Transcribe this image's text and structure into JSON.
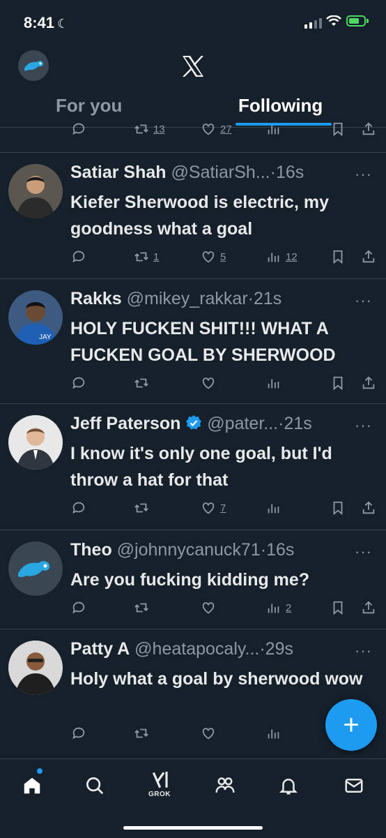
{
  "status_bar": {
    "time": "8:41",
    "focus_icon": "moon-icon",
    "signal": "signal-icon",
    "wifi": "wifi-icon",
    "battery": "battery-charging-icon"
  },
  "header": {
    "logo": "x-logo",
    "profile_avatar": "user-avatar"
  },
  "tabs": [
    {
      "label": "For you",
      "active": false
    },
    {
      "label": "Following",
      "active": true
    }
  ],
  "partial_tweet": {
    "retweets": "13",
    "likes": "27"
  },
  "tweets": [
    {
      "name": "Satiar Shah",
      "handle": "@SatiarSh...",
      "time": "·16s",
      "verified": false,
      "text": "Kiefer Sherwood is electric, my goodness what a goal",
      "replies": "",
      "retweets": "1",
      "likes": "5",
      "views": "12"
    },
    {
      "name": "Rakks",
      "handle": "@mikey_rakkar",
      "time": "·21s",
      "verified": false,
      "text": "HOLY FUCKEN SHIT!!! WHAT A FUCKEN GOAL BY SHERWOOD",
      "replies": "",
      "retweets": "",
      "likes": "",
      "views": ""
    },
    {
      "name": "Jeff Paterson",
      "handle": "@pater...",
      "time": "·21s",
      "verified": true,
      "text": "I know it's only one goal, but I'd throw a hat for that",
      "replies": "",
      "retweets": "",
      "likes": "7",
      "views": ""
    },
    {
      "name": "Theo",
      "handle": "@johnnycanuck71",
      "time": "·16s",
      "verified": false,
      "text": "Are you fucking kidding me?",
      "replies": "",
      "retweets": "",
      "likes": "",
      "views": "2"
    },
    {
      "name": "Patty A",
      "handle": "@heatapocaly...",
      "time": "·29s",
      "verified": false,
      "text": "Holy what a goal by sherwood wow",
      "replies": "",
      "retweets": "",
      "likes": "",
      "views": ""
    }
  ],
  "fab": {
    "label": "+"
  },
  "bottom_nav": {
    "items": [
      "home-icon",
      "search-icon",
      "grok-icon",
      "communities-icon",
      "notifications-icon",
      "messages-icon"
    ],
    "grok_label": "GROK"
  },
  "colors": {
    "background": "#15202b",
    "accent": "#1d9bf0",
    "muted": "#8b98a5",
    "divider": "#38444d"
  }
}
